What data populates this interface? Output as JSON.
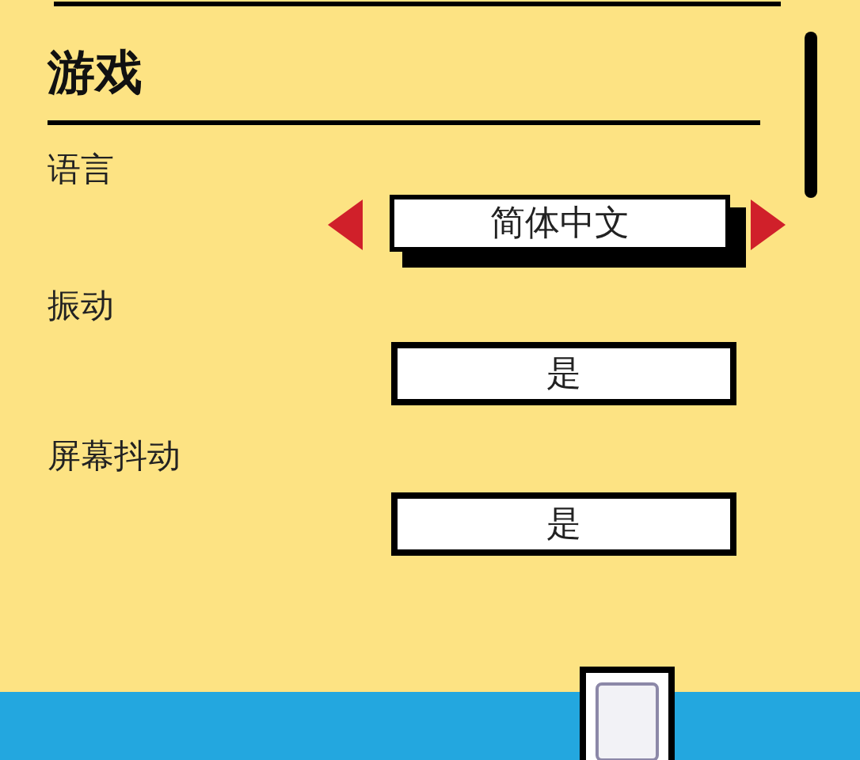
{
  "section": {
    "title": "游戏"
  },
  "settings": [
    {
      "kind": "selector",
      "label": "语言",
      "value": "简体中文"
    },
    {
      "kind": "toggle",
      "label": "振动",
      "value": "是"
    },
    {
      "kind": "toggle",
      "label": "屏幕抖动",
      "value": "是"
    }
  ]
}
